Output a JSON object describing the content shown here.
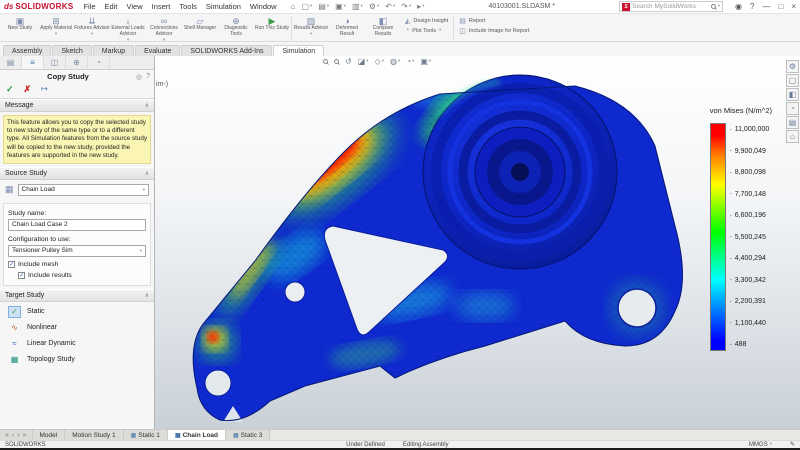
{
  "icons": {
    "caret": "▾",
    "collapse": "∧",
    "check": "✓",
    "cancel": "✗",
    "detach": "↦",
    "pin": "◎",
    "help": "?",
    "home": "⌂",
    "new_doc": "▢",
    "open": "▤",
    "save": "▣",
    "print": "▥",
    "settings": "⚙",
    "undo": "↶",
    "redo": "↷",
    "select": "▸",
    "user": "◉",
    "minimize": "—",
    "restore": "□",
    "close": "×",
    "nav_first": "«",
    "nav_prev": "‹",
    "nav_next": "›",
    "nav_last": "»",
    "pencil": "✎",
    "study": "▦",
    "pm_tabs": [
      "▤",
      "≡",
      "◫",
      "⊕",
      "◔"
    ],
    "taskpane": [
      "⚙",
      "▢",
      "◧",
      "◔",
      "▤",
      "⌂"
    ],
    "hud": [
      "⊙",
      "▭",
      "↺",
      "◪",
      "◇",
      "◍",
      "◔",
      "▣"
    ]
  },
  "titlebar": {
    "brand_mark": "ds",
    "brand": "SOLIDWORKS",
    "menus": [
      "File",
      "Edit",
      "View",
      "Insert",
      "Tools",
      "Simulation",
      "Window"
    ],
    "document_title": "40103001.SLDASM *",
    "search_placeholder": "Search MySolidWorks"
  },
  "ribbon": {
    "big": [
      {
        "label": "New Study",
        "glyph": "▣"
      },
      {
        "label": "Apply Material",
        "glyph": "⊞"
      },
      {
        "label": "Fixtures Advisor",
        "glyph": "⇊"
      },
      {
        "label": "External Loads Advisor",
        "glyph": "↓"
      },
      {
        "label": "Connections Advisor",
        "glyph": "∞"
      },
      {
        "label": "Shell Manager",
        "glyph": "▱"
      },
      {
        "label": "Diagnostic Tools",
        "glyph": "⊕"
      },
      {
        "label": "Run This Study",
        "glyph": "▶"
      },
      {
        "label": "Results Advisor",
        "glyph": "▧"
      },
      {
        "label": "Deformed Result",
        "glyph": "◑"
      },
      {
        "label": "Compare Results",
        "glyph": "◧"
      }
    ],
    "small_a": [
      {
        "label": "Design Insight",
        "glyph": "◭"
      },
      {
        "label": "Plot Tools",
        "glyph": "◔"
      }
    ],
    "small_b": [
      {
        "label": "Report",
        "glyph": "▤"
      },
      {
        "label": "Include Image for Report",
        "glyph": "◫"
      }
    ]
  },
  "tabbar": {
    "tabs": [
      "Assembly",
      "Sketch",
      "Markup",
      "Evaluate",
      "SOLIDWORKS Add-Ins",
      "Simulation"
    ],
    "active": "Simulation"
  },
  "property_manager": {
    "title": "Copy Study",
    "message_header": "Message",
    "message_text": "This feature allows you to copy the selected study to new study of the same type or to a different type. All Simulation features from the source study will be copied to the new study, provided the features are supported in the new study.",
    "source_study_header": "Source Study",
    "source_study_value": "Chain Load",
    "study_name_label": "Study name:",
    "study_name_value": "Chain Load Case 2",
    "configuration_label": "Configuration to use:",
    "configuration_value": "Tensioner Pulley Sim",
    "include_mesh_label": "Include mesh",
    "include_results_label": "Include results",
    "target_study_header": "Target Study",
    "target_selected": "Static",
    "target_options": [
      {
        "label": "Static",
        "glyph": "✓"
      },
      {
        "label": "Nonlinear",
        "glyph": "∿"
      },
      {
        "label": "Linear Dynamic",
        "glyph": "≈"
      },
      {
        "label": "Topology Study",
        "glyph": "▦"
      }
    ]
  },
  "viewport": {
    "plot_fragment": "im-)",
    "legend": {
      "title": "von Mises (N/m^2)",
      "values": [
        "11,000,000",
        "9,900,049",
        "8,800,098",
        "7,700,148",
        "6,600,196",
        "5,500,245",
        "4,400,294",
        "3,300,342",
        "2,200,391",
        "1,100,440",
        "488"
      ],
      "max_color": "#ff0000",
      "min_color": "#0000ff"
    }
  },
  "bottom_tabs": {
    "tabs": [
      "Model",
      "Motion Study 1",
      "Static 1",
      "Chain Load",
      "Static 3"
    ],
    "active": "Chain Load"
  },
  "statusbar": {
    "left": "SOLIDWORKS",
    "messages": [
      "Under Defined",
      "Editing Assembly"
    ],
    "units": "MMGS"
  }
}
